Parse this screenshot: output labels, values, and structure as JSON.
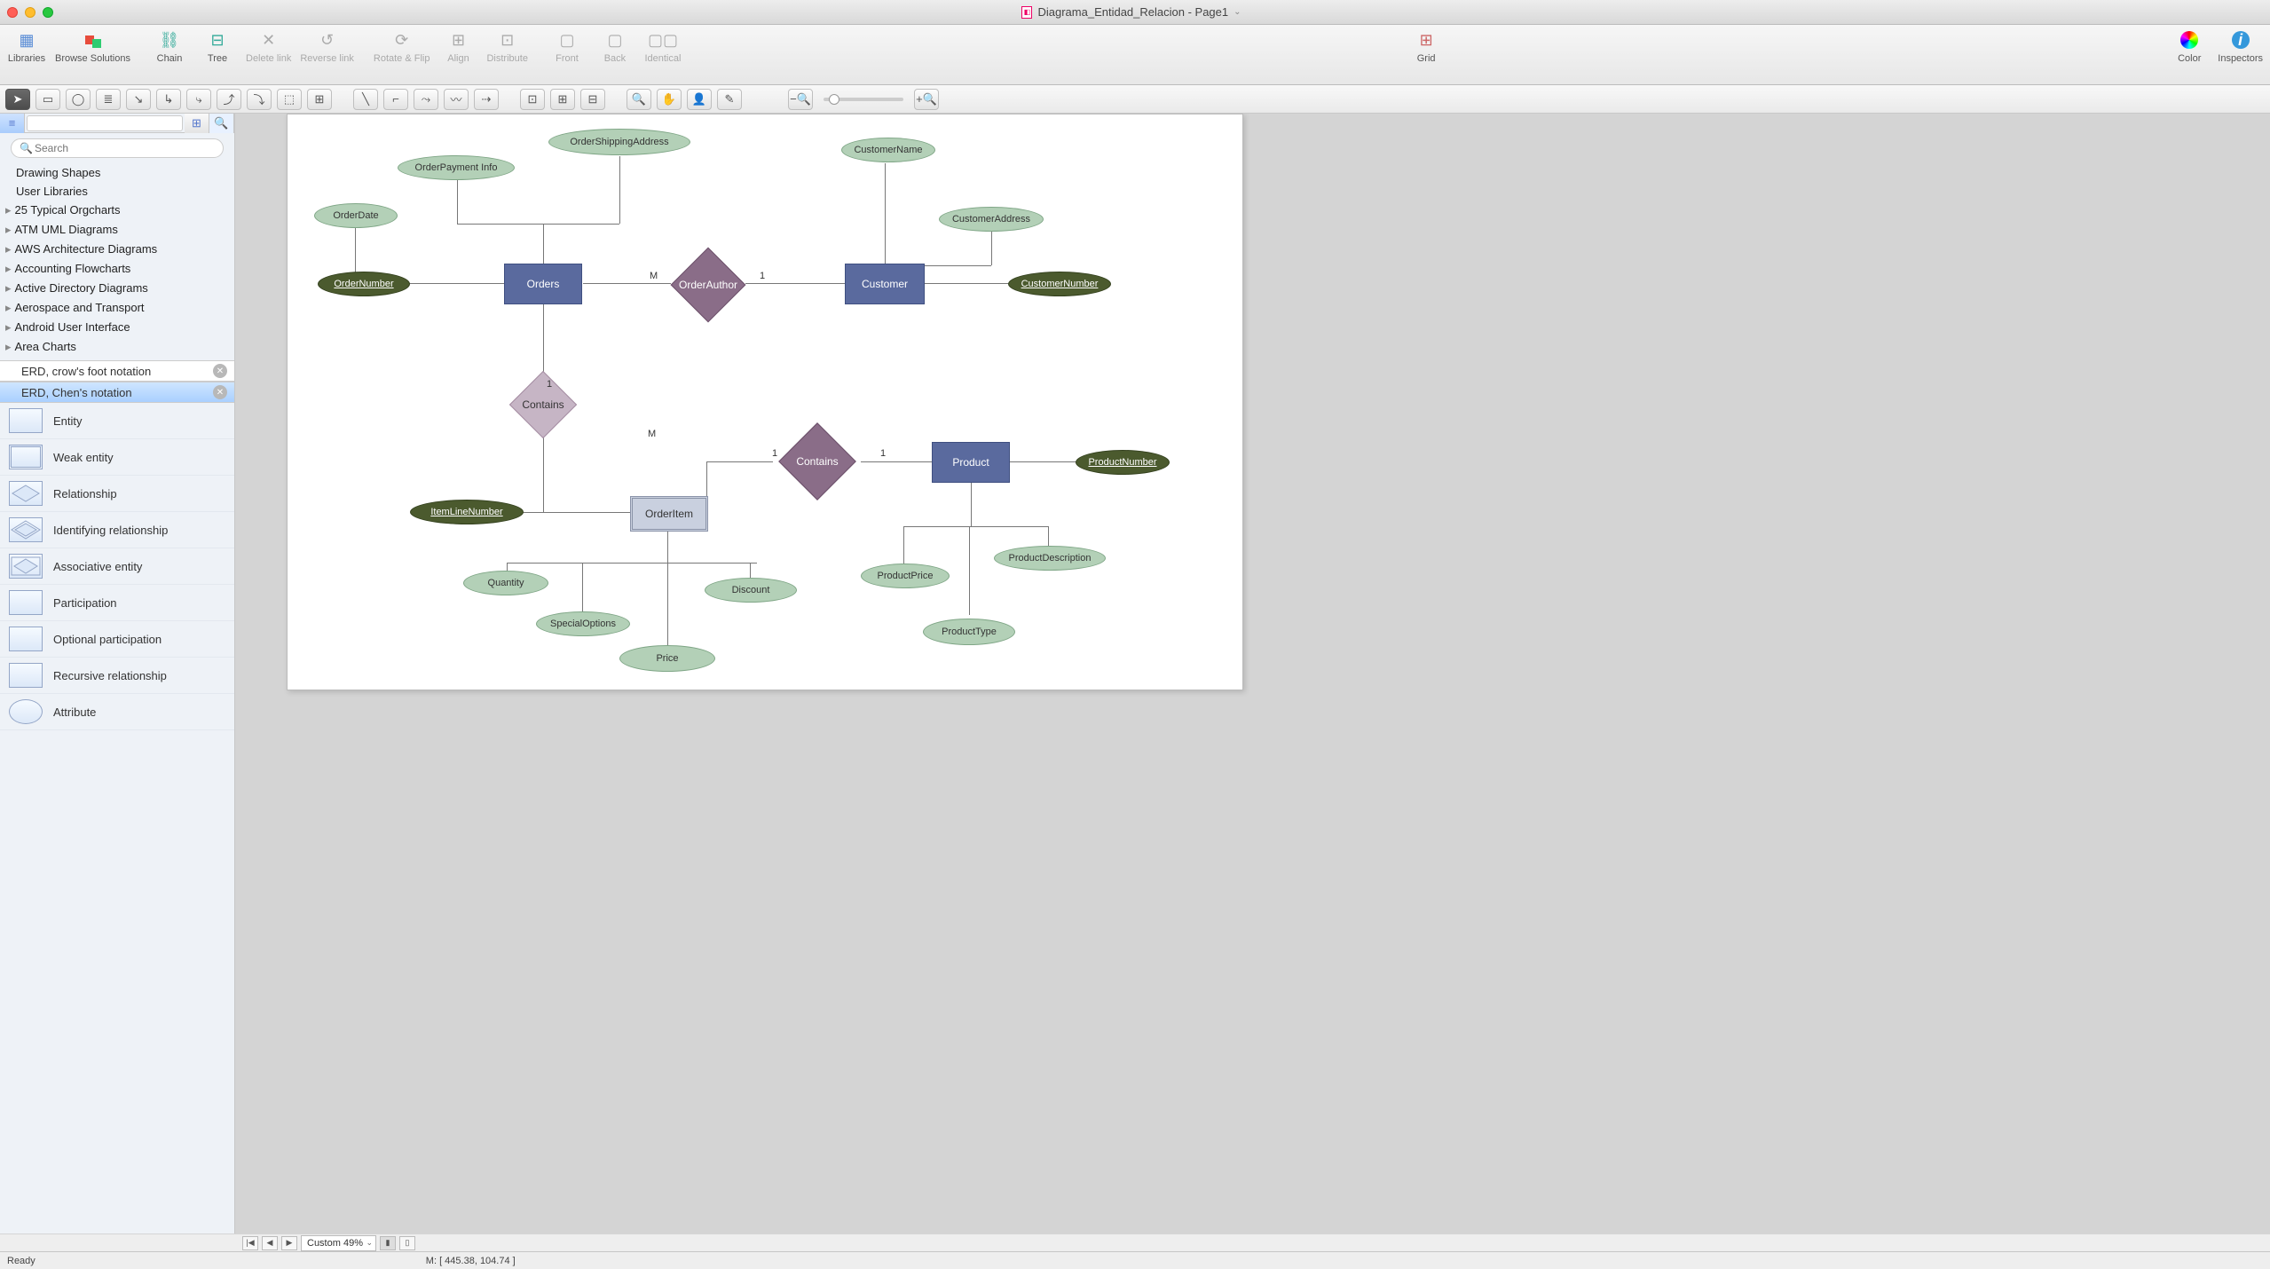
{
  "title": "Diagrama_Entidad_Relacion - Page1",
  "toolbar": {
    "libraries": "Libraries",
    "browse": "Browse Solutions",
    "chain": "Chain",
    "tree": "Tree",
    "deletelink": "Delete link",
    "reverselink": "Reverse link",
    "rotateflip": "Rotate & Flip",
    "align": "Align",
    "distribute": "Distribute",
    "front": "Front",
    "back": "Back",
    "identical": "Identical",
    "grid": "Grid",
    "color": "Color",
    "inspectors": "Inspectors"
  },
  "search": {
    "placeholder": "Search"
  },
  "libs": {
    "items": [
      "Drawing Shapes",
      "User Libraries",
      "25 Typical Orgcharts",
      "ATM UML Diagrams",
      "AWS Architecture Diagrams",
      "Accounting Flowcharts",
      "Active Directory Diagrams",
      "Aerospace and Transport",
      "Android User Interface",
      "Area Charts"
    ]
  },
  "sections": {
    "crowfoot": "ERD, crow's foot notation",
    "chen": "ERD, Chen's notation"
  },
  "shapes": [
    "Entity",
    "Weak entity",
    "Relationship",
    "Identifying relationship",
    "Associative entity",
    "Participation",
    "Optional participation",
    "Recursive relationship",
    "Attribute"
  ],
  "diagram": {
    "orders": "Orders",
    "customer": "Customer",
    "product": "Product",
    "orderitem": "OrderItem",
    "ordernumber": "OrderNumber",
    "customernumber": "CustomerNumber",
    "productnumber": "ProductNumber",
    "itemlinenumber": "ItemLineNumber",
    "orderdate": "OrderDate",
    "orderpayment": "OrderPayment Info",
    "ordershipping": "OrderShippingAddress",
    "customername": "CustomerName",
    "customeraddress": "CustomerAddress",
    "quantity": "Quantity",
    "specialoptions": "SpecialOptions",
    "price": "Price",
    "discount": "Discount",
    "productprice": "ProductPrice",
    "producttype": "ProductType",
    "productdesc": "ProductDescription",
    "orderauthor": "OrderAuthor",
    "contains": "Contains",
    "card_m": "M",
    "card_1": "1"
  },
  "zoom": "Custom 49%",
  "status": {
    "ready": "Ready",
    "mouse": "M: [ 445.38, 104.74 ]"
  }
}
